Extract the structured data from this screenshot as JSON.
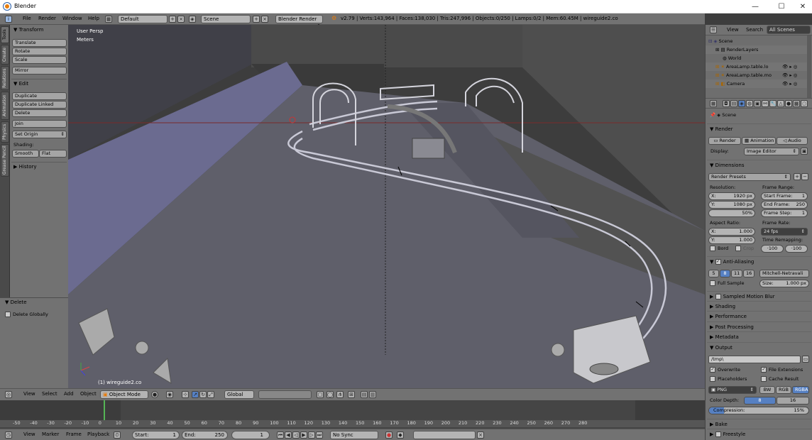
{
  "window": {
    "title": "Blender",
    "minimize": "—",
    "maximize": "☐",
    "close": "✕"
  },
  "info_header": {
    "menus": [
      "File",
      "Render",
      "Window",
      "Help"
    ],
    "screen": "Default",
    "scene": "Scene",
    "engine": "Blender Render",
    "stats": "v2.79 | Verts:143,964 | Faces:138,030 | Tris:247,996 | Objects:0/250 | Lamps:0/2 | Mem:60.45M | wireguide2.co"
  },
  "tool_tabs": [
    "Tools",
    "Create",
    "Relations",
    "Animation",
    "Physics",
    "Grease Pencil"
  ],
  "toolshelf": {
    "transform": {
      "header": "Transform",
      "buttons": [
        "Translate",
        "Rotate",
        "Scale"
      ],
      "mirror": "Mirror"
    },
    "edit": {
      "header": "Edit",
      "buttons": [
        "Duplicate",
        "Duplicate Linked",
        "Delete"
      ],
      "join": "Join",
      "set_origin": "Set Origin",
      "shading_label": "Shading:",
      "smooth": "Smooth",
      "flat": "Flat"
    },
    "history": {
      "header": "History"
    }
  },
  "operator_panel": {
    "header": "Delete",
    "option": "Delete Globally"
  },
  "viewport": {
    "view_name": "User Persp",
    "units": "Meters",
    "object_info": "(1) wireguide2.co"
  },
  "view3d_header": {
    "menus": [
      "View",
      "Select",
      "Add",
      "Object"
    ],
    "mode": "Object Mode",
    "orientation": "Global"
  },
  "timeline": {
    "ticks": [
      "-50",
      "-40",
      "-30",
      "-20",
      "-10",
      "0",
      "10",
      "20",
      "30",
      "40",
      "50",
      "60",
      "70",
      "80",
      "90",
      "100",
      "110",
      "120",
      "130",
      "140",
      "150",
      "160",
      "170",
      "180",
      "190",
      "200",
      "210",
      "220",
      "230",
      "240",
      "250",
      "260",
      "270",
      "280"
    ],
    "current_frame": 1,
    "menus": [
      "View",
      "Marker",
      "Frame",
      "Playback"
    ],
    "start": "Start:",
    "start_value": "1",
    "end": "End:",
    "end_value": "250",
    "frame_value": "1",
    "sync": "No Sync"
  },
  "outliner": {
    "tabs": [
      "View",
      "Search",
      "All Scenes"
    ],
    "rows": [
      "Scene",
      "RenderLayers",
      "World",
      "AreaLamp.table.lo",
      "AreaLamp.table.mo",
      "Camera"
    ]
  },
  "properties": {
    "context": "Scene",
    "render": {
      "header": "Render",
      "buttons": [
        "Render",
        "Animation",
        "Audio"
      ],
      "display_label": "Display:",
      "display_value": "Image Editor"
    },
    "dimensions": {
      "header": "Dimensions",
      "presets": "Render Presets",
      "resolution_label": "Resolution:",
      "res_x": "X:",
      "res_x_value": "1920 px",
      "res_y": "Y:",
      "res_y_value": "1080 px",
      "res_pct": "50%",
      "frame_range_label": "Frame Range:",
      "start": "Start Frame:",
      "start_value": "1",
      "end": "End Frame:",
      "end_value": "250",
      "step": "Frame Step:",
      "step_value": "1",
      "aspect_label": "Aspect Ratio:",
      "asp_x": "X:",
      "asp_x_value": "1.000",
      "asp_y": "Y:",
      "asp_y_value": "1.000",
      "frame_rate_label": "Frame Rate:",
      "fps": "24 fps",
      "time_remap_label": "Time Remapping:",
      "remap_old": "·100",
      "remap_new": "·100",
      "border": "Bord",
      "crop": "Crop"
    },
    "anti_aliasing": {
      "header": "Anti-Aliasing",
      "samples": [
        "5",
        "8",
        "11",
        "16"
      ],
      "selected_sample": "8",
      "filter": "Mitchell-Netravali",
      "full_sample": "Full Sample",
      "size_label": "Size:",
      "size_value": "1.000 px"
    },
    "collapsed_sections": [
      "Sampled Motion Blur",
      "Shading",
      "Performance",
      "Post Processing",
      "Metadata"
    ],
    "output": {
      "header": "Output",
      "path": "/tmp\\",
      "overwrite": "Overwrite",
      "file_extensions": "File Extensions",
      "placeholders": "Placeholders",
      "cache_result": "Cache Result",
      "format": "PNG",
      "color_modes": [
        "BW",
        "RGB",
        "RGBA"
      ],
      "selected_color_mode": "RGBA",
      "color_depth_label": "Color Depth:",
      "depths": [
        "8",
        "16"
      ],
      "selected_depth": "8",
      "compression_label": "Compression:",
      "compression_value": "15%",
      "compression": 0.15
    },
    "bottom_sections": [
      "Bake",
      "Freestyle"
    ]
  }
}
